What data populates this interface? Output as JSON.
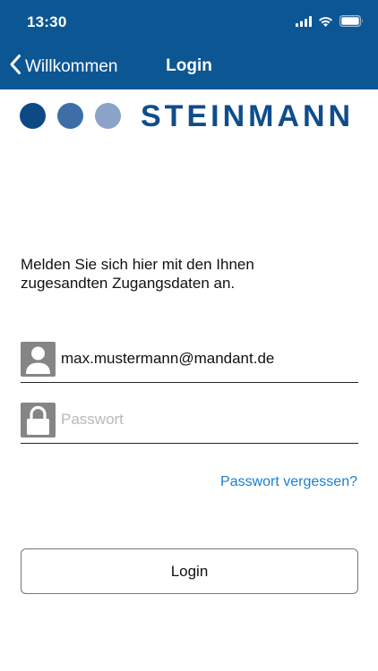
{
  "status_bar": {
    "time": "13:30",
    "icons": [
      "cellular-signal-icon",
      "wifi-icon",
      "battery-icon"
    ]
  },
  "nav": {
    "back_label": "Willkommen",
    "title": "Login"
  },
  "brand": {
    "logo_text": "STEINMANN",
    "dot_colors": [
      "#0d4a85",
      "#3e6ea7",
      "#8aa3c6"
    ]
  },
  "intro_text": "Melden Sie sich hier mit den Ihnen zugesandten Zugangsdaten an.",
  "form": {
    "email": {
      "value": "max.mustermann@mandant.de",
      "icon": "user-icon"
    },
    "password": {
      "placeholder": "Passwort",
      "value": "",
      "icon": "lock-icon"
    },
    "forgot_label": "Passwort vergessen?",
    "login_label": "Login"
  },
  "colors": {
    "header_bg": "#0d5694",
    "link": "#1a7fd0",
    "field_icon_bg": "#858585"
  }
}
